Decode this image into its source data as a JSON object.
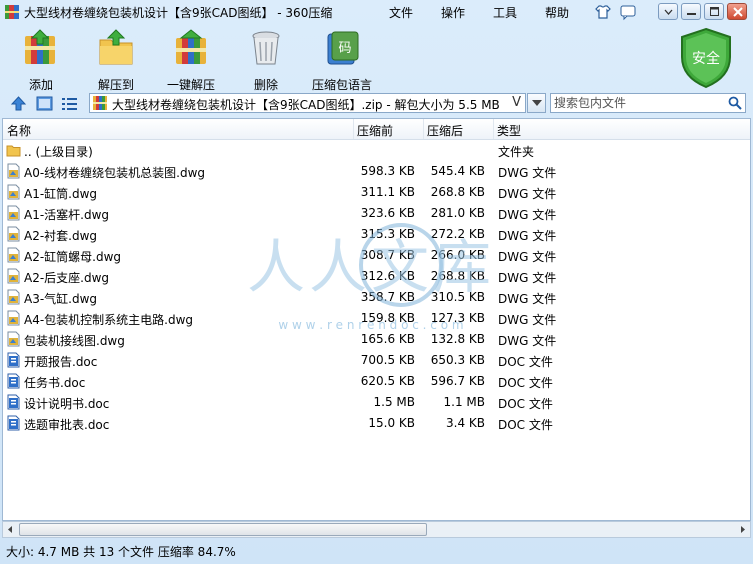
{
  "window": {
    "title": "大型线材卷缠绕包装机设计【含9张CAD图纸】 - 360压缩"
  },
  "menu": [
    "文件",
    "操作",
    "工具",
    "帮助"
  ],
  "toolbar": [
    {
      "label": "添加",
      "icon": "add-archive-icon"
    },
    {
      "label": "解压到",
      "icon": "extract-to-icon"
    },
    {
      "label": "一键解压",
      "icon": "one-click-extract-icon"
    },
    {
      "label": "删除",
      "icon": "trash-icon"
    },
    {
      "label": "压缩包语言",
      "icon": "archive-language-icon"
    }
  ],
  "safe_badge": "安全",
  "address": {
    "path": "大型线材卷缠绕包装机设计【含9张CAD图纸】.zip - 解包大小为 5.5 MB",
    "dropdown_glyph": "V",
    "search_placeholder": "搜索包内文件"
  },
  "columns": {
    "name": "名称",
    "compressed": "压缩前",
    "original": "压缩后",
    "type": "类型"
  },
  "files": [
    {
      "name": ".. (上级目录)",
      "before": "",
      "after": "",
      "type": "文件夹",
      "kind": "folder"
    },
    {
      "name": "A0-线材卷缠绕包装机总装图.dwg",
      "before": "598.3 KB",
      "after": "545.4 KB",
      "type": "DWG 文件",
      "kind": "dwg"
    },
    {
      "name": "A1-缸筒.dwg",
      "before": "311.1 KB",
      "after": "268.8 KB",
      "type": "DWG 文件",
      "kind": "dwg"
    },
    {
      "name": "A1-活塞杆.dwg",
      "before": "323.6 KB",
      "after": "281.0 KB",
      "type": "DWG 文件",
      "kind": "dwg"
    },
    {
      "name": "A2-衬套.dwg",
      "before": "315.3 KB",
      "after": "272.2 KB",
      "type": "DWG 文件",
      "kind": "dwg"
    },
    {
      "name": "A2-缸筒螺母.dwg",
      "before": "308.7 KB",
      "after": "266.0 KB",
      "type": "DWG 文件",
      "kind": "dwg"
    },
    {
      "name": "A2-后支座.dwg",
      "before": "312.6 KB",
      "after": "268.8 KB",
      "type": "DWG 文件",
      "kind": "dwg"
    },
    {
      "name": "A3-气缸.dwg",
      "before": "358.7 KB",
      "after": "310.5 KB",
      "type": "DWG 文件",
      "kind": "dwg"
    },
    {
      "name": "A4-包装机控制系统主电路.dwg",
      "before": "159.8 KB",
      "after": "127.3 KB",
      "type": "DWG 文件",
      "kind": "dwg"
    },
    {
      "name": "包装机接线图.dwg",
      "before": "165.6 KB",
      "after": "132.8 KB",
      "type": "DWG 文件",
      "kind": "dwg"
    },
    {
      "name": "开题报告.doc",
      "before": "700.5 KB",
      "after": "650.3 KB",
      "type": "DOC 文件",
      "kind": "doc"
    },
    {
      "name": "任务书.doc",
      "before": "620.5 KB",
      "after": "596.7 KB",
      "type": "DOC 文件",
      "kind": "doc"
    },
    {
      "name": "设计说明书.doc",
      "before": "1.5 MB",
      "after": "1.1 MB",
      "type": "DOC 文件",
      "kind": "doc"
    },
    {
      "name": "选题审批表.doc",
      "before": "15.0 KB",
      "after": "3.4 KB",
      "type": "DOC 文件",
      "kind": "doc"
    }
  ],
  "watermark": {
    "text": "人人文库",
    "url": "w w w . r e n r e n d o c . c o m"
  },
  "status": "大小: 4.7 MB 共 13 个文件 压缩率 84.7%"
}
